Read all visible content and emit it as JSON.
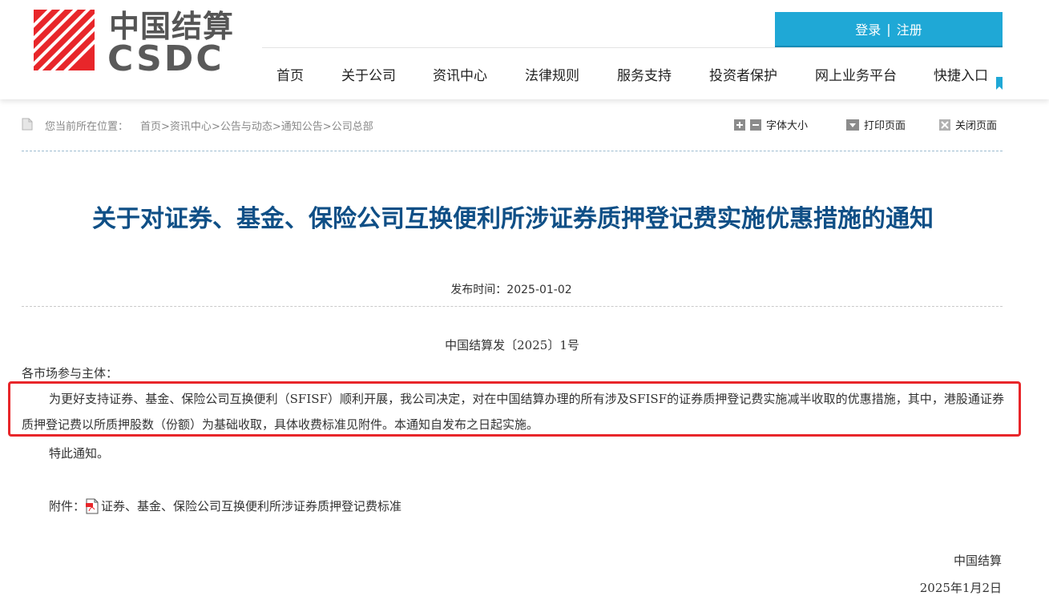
{
  "header": {
    "logo_cn": "中国结算",
    "logo_en": "CSDC",
    "login_label": "登录",
    "separator": "|",
    "register_label": "注册",
    "brand_color": "#e8262a",
    "accent_color": "#1fa8d6"
  },
  "nav": [
    {
      "label": "首页"
    },
    {
      "label": "关于公司"
    },
    {
      "label": "资讯中心"
    },
    {
      "label": "法律规则"
    },
    {
      "label": "服务支持"
    },
    {
      "label": "投资者保护"
    },
    {
      "label": "网上业务平台"
    },
    {
      "label": "快捷入口"
    }
  ],
  "breadcrumb": {
    "label": "您当前所在位置：",
    "items": [
      "首页",
      "资讯中心",
      "公告与动态",
      "通知公告",
      "公司总部"
    ],
    "separator": ">"
  },
  "tools": {
    "font_size": "字体大小",
    "print": "打印页面",
    "close": "关闭页面"
  },
  "article": {
    "title": "关于对证券、基金、保险公司互换便利所涉证券质押登记费实施优惠措施的通知",
    "publish_time": "发布时间：2025-01-02",
    "doc_number": "中国结算发〔2025〕1号",
    "salutation": "各市场参与主体：",
    "paragraph": "为更好支持证券、基金、保险公司互换便利（SFISF）顺利开展，我公司决定，对在中国结算办理的所有涉及SFISF的证券质押登记费实施减半收取的优惠措施，其中，港股通证券质押登记费以所质押股数（份额）为基础收取，具体收费标准见附件。本通知自发布之日起实施。",
    "closing": "特此通知。",
    "attachment_label": "附件：",
    "attachment_name": "证券、基金、保险公司互换便利所涉证券质押登记费标准",
    "signature": "中国结算",
    "date": "2025年1月2日",
    "title_color": "#0f4f86",
    "highlight_color": "#e8262a"
  }
}
